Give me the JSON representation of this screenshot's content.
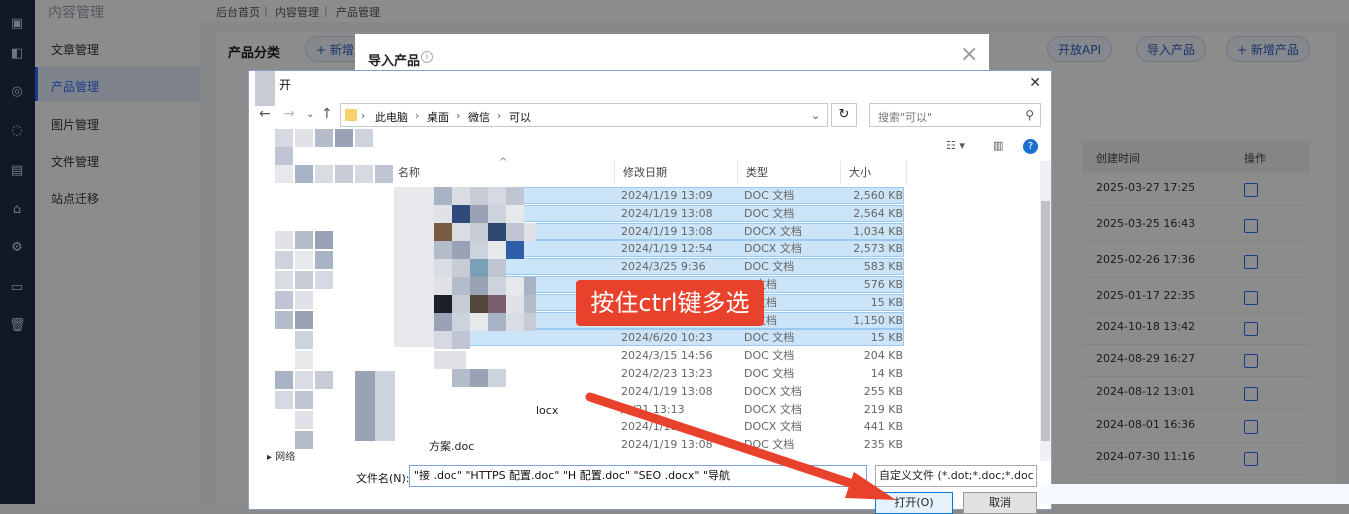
{
  "app": {
    "side_title": "内容管理",
    "menu": [
      "文章管理",
      "产品管理",
      "图片管理",
      "文件管理",
      "站点迁移"
    ],
    "breadcrumb": [
      "后台首页",
      "内容管理",
      "产品管理"
    ],
    "section_title": "产品分类",
    "new_btn": "+ 新增",
    "pills": [
      "开放API",
      "导入产品",
      "+ 新增产品"
    ],
    "table_headers": [
      "创建时间",
      "操作"
    ],
    "dates": [
      "2025-03-27 17:25",
      "2025-03-25 16:43",
      "2025-02-26 17:36",
      "2025-01-17 22:35",
      "2024-10-18 13:42",
      "2024-08-29 16:27",
      "2024-08-12 13:01",
      "2024-08-01 16:36",
      "2024-07-30 11:16"
    ]
  },
  "modal": {
    "title": "导入产品",
    "close": "×"
  },
  "dialog": {
    "title": "开",
    "path": [
      "此电脑",
      "桌面",
      "微信",
      "可以"
    ],
    "search_placeholder": "搜索\"可以\"",
    "columns": [
      "名称",
      "修改日期",
      "类型",
      "大小"
    ],
    "rows": [
      {
        "date": "2024/1/19 13:09",
        "type": "DOC 文档",
        "size": "2,560 KB"
      },
      {
        "date": "2024/1/19 13:08",
        "type": "DOC 文档",
        "size": "2,564 KB"
      },
      {
        "date": "2024/1/19 13:08",
        "type": "DOCX 文档",
        "size": "1,034 KB"
      },
      {
        "date": "2024/1/19 12:54",
        "type": "DOCX 文档",
        "size": "2,573 KB"
      },
      {
        "date": "2024/3/25 9:36",
        "type": "DOC 文档",
        "size": "583 KB"
      },
      {
        "date": "",
        "type": "X 文档",
        "size": "576 KB"
      },
      {
        "date": "",
        "type": "X 文档",
        "size": "15 KB"
      },
      {
        "date": "",
        "type": "X 文档",
        "size": "1,150 KB"
      },
      {
        "date": "2024/6/20 10:23",
        "type": "DOC 文档",
        "size": "15 KB"
      },
      {
        "date": "2024/3/15 14:56",
        "type": "DOC 文档",
        "size": "204 KB"
      },
      {
        "date": "2024/2/23 13:23",
        "type": "DOC 文档",
        "size": "14 KB"
      },
      {
        "date": "2024/1/19 13:08",
        "type": "DOCX 文档",
        "size": "255 KB"
      },
      {
        "date": "/3/21 13:13",
        "type": "DOCX 文档",
        "size": "219 KB"
      },
      {
        "date": "2024/1/19",
        "type": "DOCX 文档",
        "size": "441 KB"
      },
      {
        "date": "2024/1/19 13:08",
        "type": "DOC 文档",
        "size": "235 KB"
      }
    ],
    "name_fragments": [
      "locx",
      "方案.doc"
    ],
    "nav_label": "网络",
    "filename_label": "文件名(N):",
    "filename_value": "\"接 .doc\" \"HTTPS 配置.doc\" \"H 配置.doc\" \"SEO .docx\" \"导航",
    "filetype": "自定义文件 (*.dot;*.doc;*.doc",
    "open_btn": "打开(O)",
    "cancel_btn": "取消"
  },
  "annotation": "按住ctrl键多选",
  "colors": {
    "accent": "#2f6bff",
    "annotation": "#e8412c",
    "selection": "#cce4f7"
  }
}
